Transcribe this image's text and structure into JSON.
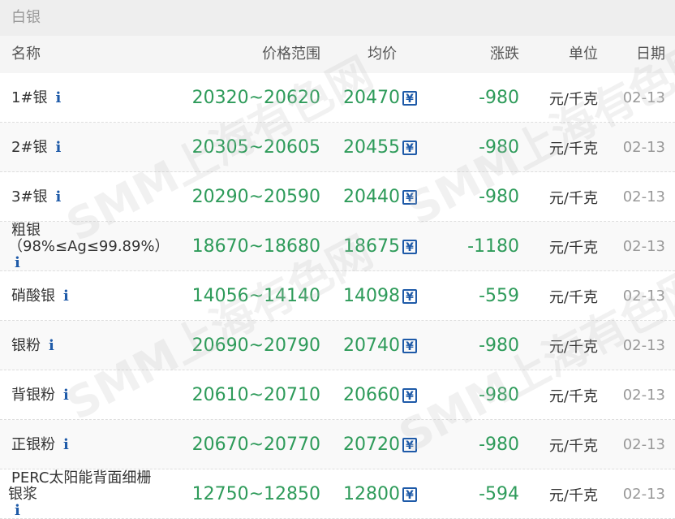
{
  "panel": {
    "title": "白银"
  },
  "columns": {
    "name": "名称",
    "range": "价格范围",
    "avg": "均价",
    "change": "涨跌",
    "unit": "单位",
    "date": "日期"
  },
  "watermark": "SMM上海有色网",
  "rows": [
    {
      "name": "1#银",
      "range": "20320~20620",
      "avg": "20470",
      "change": "-980",
      "unit": "元/千克",
      "date": "02-13"
    },
    {
      "name": "2#银",
      "range": "20305~20605",
      "avg": "20455",
      "change": "-980",
      "unit": "元/千克",
      "date": "02-13"
    },
    {
      "name": "3#银",
      "range": "20290~20590",
      "avg": "20440",
      "change": "-980",
      "unit": "元/千克",
      "date": "02-13"
    },
    {
      "name": "粗银",
      "name_sub": "（98%≤Ag≤99.89%）",
      "range": "18670~18680",
      "avg": "18675",
      "change": "-1180",
      "unit": "元/千克",
      "date": "02-13"
    },
    {
      "name": "硝酸银",
      "range": "14056~14140",
      "avg": "14098",
      "change": "-559",
      "unit": "元/千克",
      "date": "02-13"
    },
    {
      "name": "银粉",
      "range": "20690~20790",
      "avg": "20740",
      "change": "-980",
      "unit": "元/千克",
      "date": "02-13"
    },
    {
      "name": "背银粉",
      "range": "20610~20710",
      "avg": "20660",
      "change": "-980",
      "unit": "元/千克",
      "date": "02-13"
    },
    {
      "name": "正银粉",
      "range": "20670~20770",
      "avg": "20720",
      "change": "-980",
      "unit": "元/千克",
      "date": "02-13"
    },
    {
      "name": "PERC太阳能背面细栅",
      "name_sub": "银浆",
      "range": "12750~12850",
      "avg": "12800",
      "change": "-594",
      "unit": "元/千克",
      "date": "02-13"
    }
  ],
  "icons": {
    "info": "i",
    "yen": "¥",
    "info_icon_name": "info-icon",
    "yen_icon_name": "yen-chart-icon"
  },
  "colors": {
    "price_green": "#2e9b5a",
    "icon_blue": "#1e5aa8",
    "header_bg": "#f5f5f5",
    "title_bg": "#eeeeee"
  }
}
